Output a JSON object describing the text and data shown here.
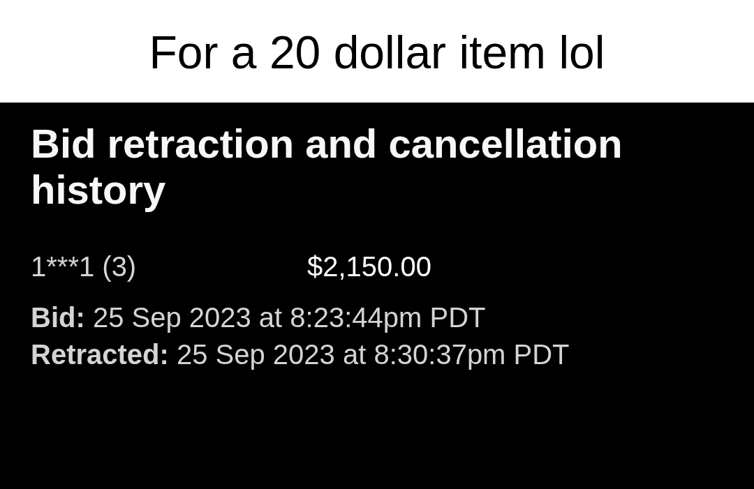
{
  "caption": "For a 20 dollar item lol",
  "panel": {
    "title": "Bid retraction and cancellation history",
    "entries": [
      {
        "bidder": "1***1 (3)",
        "amount": "$2,150.00",
        "details": [
          "**Bid:** 25 Sep 2023 at 8:23:44pm PDT",
          "**Retracted:** 25 Sep 2023 at 8:30:37pm PDT"
        ]
      }
    ]
  }
}
